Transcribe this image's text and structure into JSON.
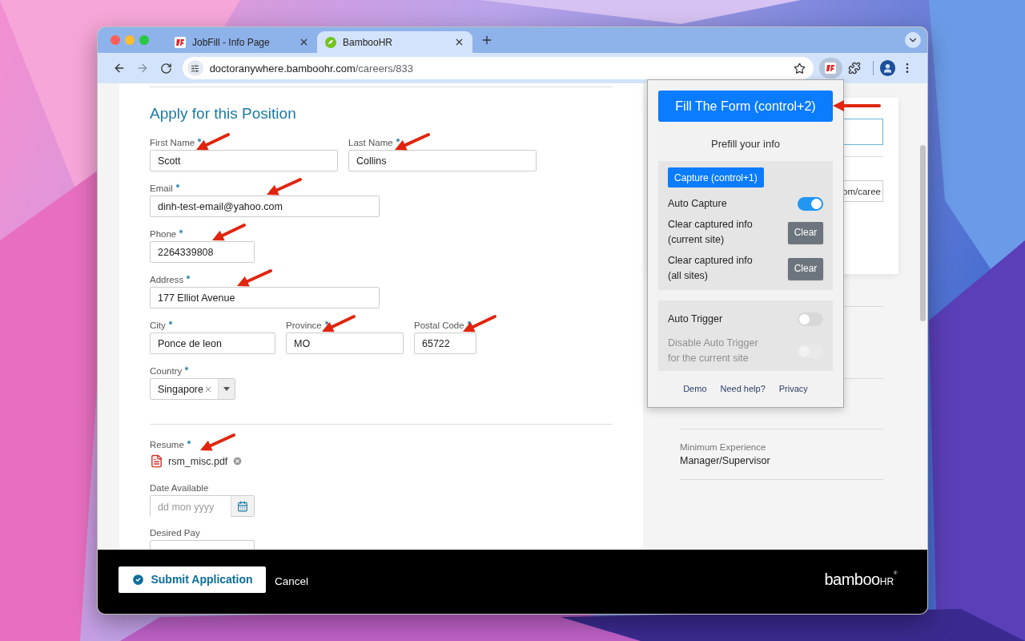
{
  "browser": {
    "tabs": [
      {
        "title": "JobFill - Info Page",
        "selected": false
      },
      {
        "title": "BambooHR",
        "selected": true
      }
    ],
    "url": {
      "host": "doctoranywhere.bamboohr.com",
      "path": "/careers/833"
    },
    "forward_enabled": false
  },
  "form": {
    "title": "Apply for this Position",
    "rows": [
      [
        {
          "kind": "text",
          "label": "First Name",
          "required": true,
          "value": "Scott"
        },
        {
          "kind": "text",
          "label": "Last Name",
          "required": true,
          "value": "Collins"
        }
      ],
      [
        {
          "kind": "text",
          "label": "Email",
          "required": true,
          "value": "dinh-test-email@yahoo.com"
        }
      ],
      [
        {
          "kind": "text",
          "label": "Phone",
          "required": true,
          "value": "2264339808"
        }
      ],
      [
        {
          "kind": "text",
          "label": "Address",
          "required": true,
          "value": "177 Elliot Avenue"
        }
      ],
      [
        {
          "kind": "text",
          "label": "City",
          "required": true,
          "value": "Ponce de leon"
        },
        {
          "kind": "text",
          "label": "Province",
          "required": true,
          "value": "MO"
        },
        {
          "kind": "text",
          "label": "Postal Code",
          "required": true,
          "value": "65722"
        }
      ],
      [
        {
          "kind": "select",
          "label": "Country",
          "required": true,
          "value": "Singapore"
        }
      ]
    ],
    "resume": {
      "label": "Resume",
      "required": true,
      "file": "rsm_misc.pdf"
    },
    "date": {
      "label": "Date Available",
      "placeholder": "dd mon yyyy"
    },
    "pay": {
      "label": "Desired Pay"
    }
  },
  "side": {
    "url_fragment": "om/caree",
    "details": [
      {
        "label": "Minimum Experience",
        "value": "Manager/Supervisor"
      }
    ]
  },
  "popup": {
    "fill_button": "Fill The Form (control+2)",
    "subtitle": "Prefill your info",
    "capture_button": "Capture (control+1)",
    "capture_rows": [
      {
        "kind": "toggle",
        "label": "Auto Capture",
        "on": true,
        "disabled": false
      },
      {
        "kind": "clear",
        "label": "Clear captured info (current site)",
        "button": "Clear"
      },
      {
        "kind": "clear",
        "label": "Clear captured info (all sites)",
        "button": "Clear"
      }
    ],
    "trigger_rows": [
      {
        "kind": "toggle",
        "label": "Auto Trigger",
        "on": false,
        "disabled": false
      },
      {
        "kind": "toggle",
        "label": "Disable Auto Trigger for the current site",
        "on": false,
        "disabled": true
      }
    ],
    "links": [
      "Demo",
      "Need help?",
      "Privacy"
    ]
  },
  "footer": {
    "submit": "Submit Application",
    "cancel": "Cancel",
    "logo": {
      "word": "bamboo",
      "suffix": "HR",
      "mark": "®"
    }
  }
}
